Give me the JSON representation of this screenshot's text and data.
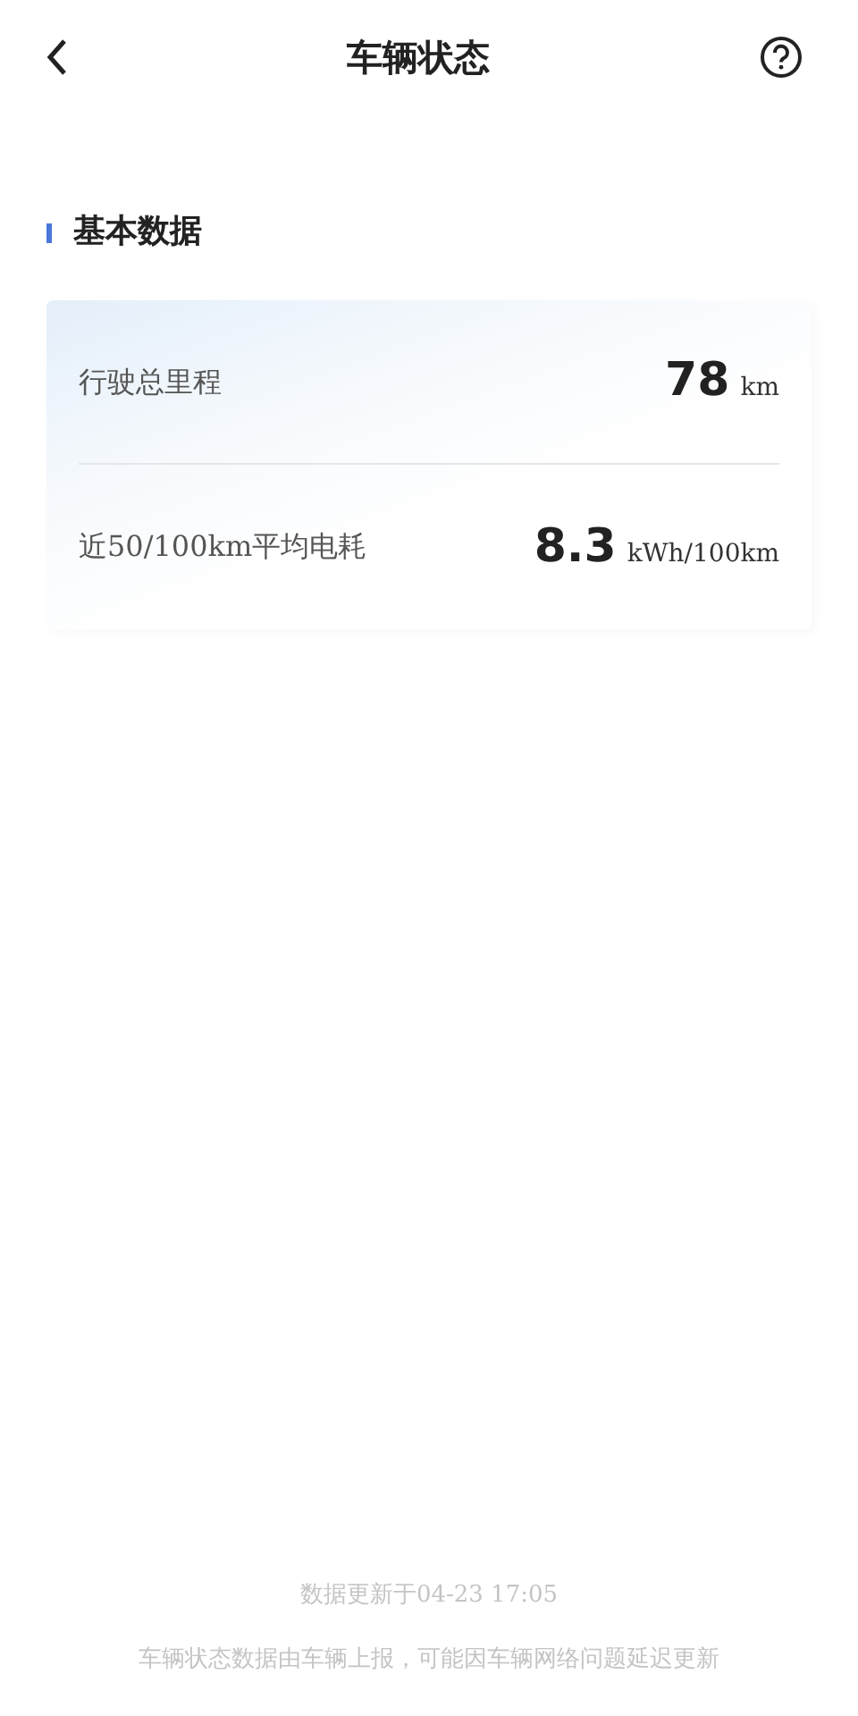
{
  "header": {
    "title": "车辆状态"
  },
  "section": {
    "title": "基本数据"
  },
  "metrics": [
    {
      "label": "行驶总里程",
      "value": "78",
      "unit": "km"
    },
    {
      "label": "近50/100km平均电耗",
      "value": "8.3",
      "unit": "kWh/100km"
    }
  ],
  "footer": {
    "updated": "数据更新于04-23 17:05",
    "note": "车辆状态数据由车辆上报，可能因车辆网络问题延迟更新"
  }
}
